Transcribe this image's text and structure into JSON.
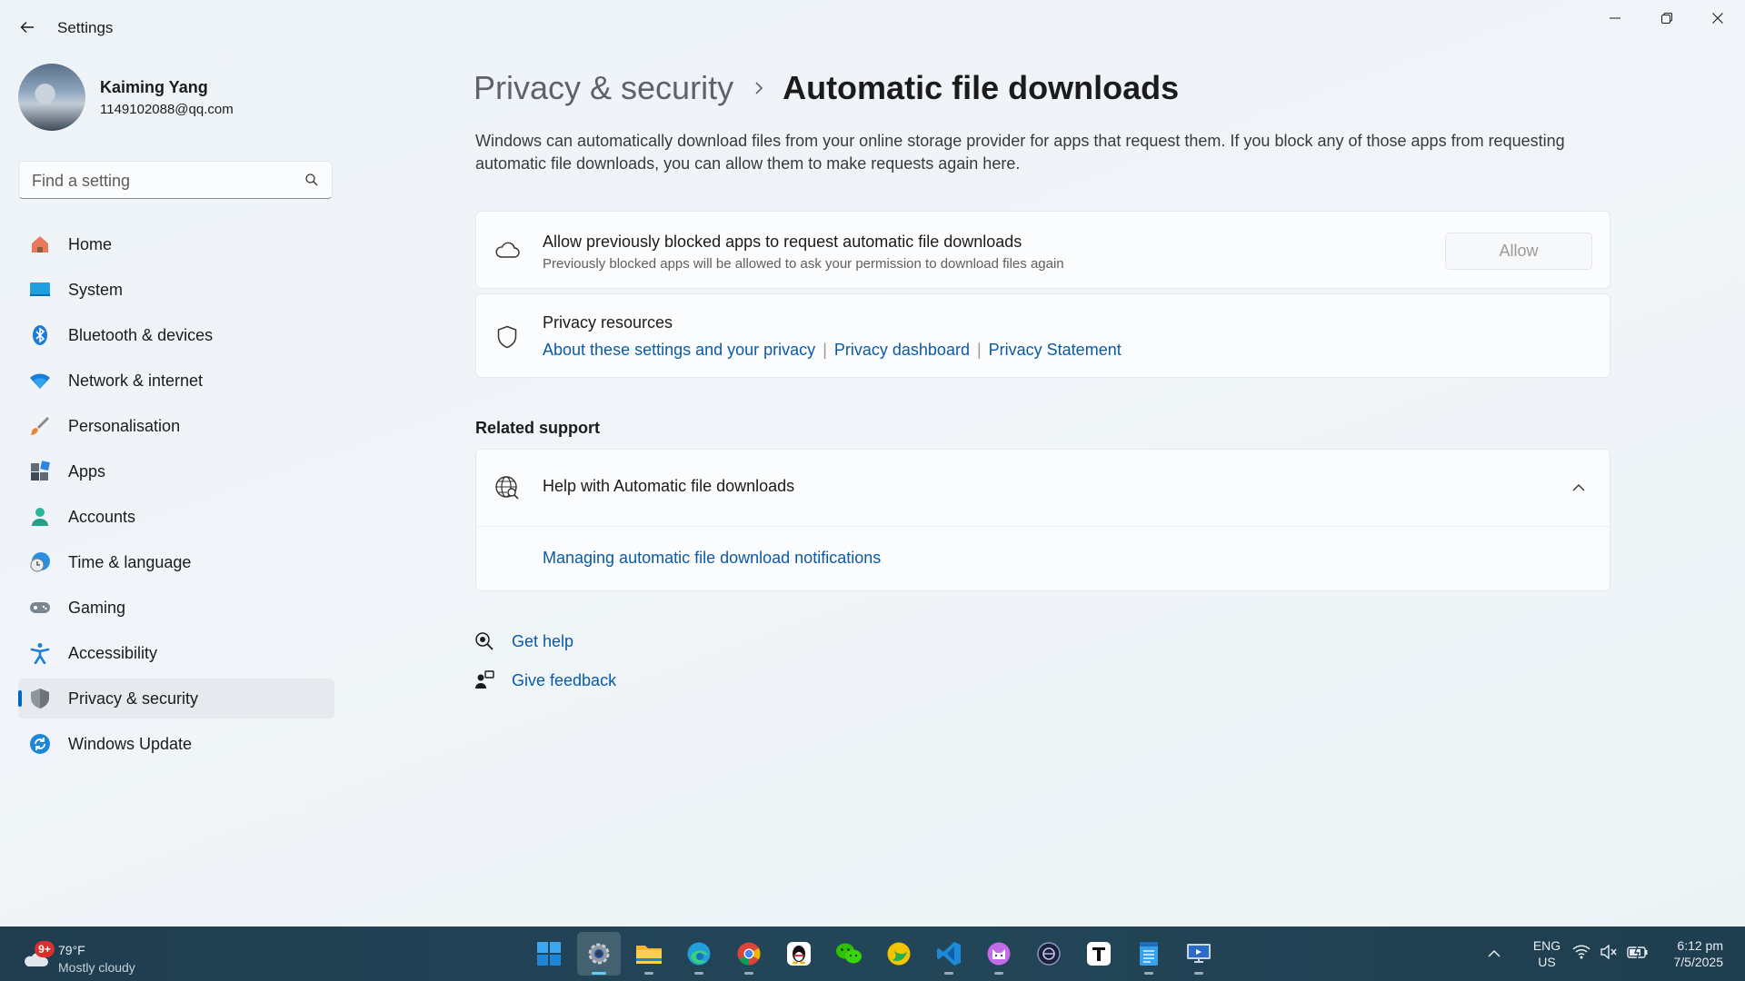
{
  "window": {
    "title": "Settings"
  },
  "user": {
    "name": "Kaiming Yang",
    "email": "1149102088@qq.com"
  },
  "search": {
    "placeholder": "Find a setting"
  },
  "sidebar": {
    "items": [
      {
        "label": "Home",
        "icon": "home-icon"
      },
      {
        "label": "System",
        "icon": "system-icon"
      },
      {
        "label": "Bluetooth & devices",
        "icon": "bluetooth-icon"
      },
      {
        "label": "Network & internet",
        "icon": "wifi-icon"
      },
      {
        "label": "Personalisation",
        "icon": "brush-icon"
      },
      {
        "label": "Apps",
        "icon": "apps-icon"
      },
      {
        "label": "Accounts",
        "icon": "accounts-icon"
      },
      {
        "label": "Time & language",
        "icon": "clock-globe-icon"
      },
      {
        "label": "Gaming",
        "icon": "gamepad-icon"
      },
      {
        "label": "Accessibility",
        "icon": "accessibility-icon"
      },
      {
        "label": "Privacy & security",
        "icon": "shield-icon",
        "active": true
      },
      {
        "label": "Windows Update",
        "icon": "update-icon"
      }
    ]
  },
  "breadcrumb": {
    "parent": "Privacy & security",
    "current": "Automatic file downloads"
  },
  "description": "Windows can automatically download files from your online storage provider for apps that request them. If you block any of those apps from requesting automatic file downloads, you can allow them to make requests again here.",
  "allow_card": {
    "title": "Allow previously blocked apps to request automatic file downloads",
    "subtitle": "Previously blocked apps will be allowed to ask your permission to download files again",
    "button": "Allow"
  },
  "privacy_card": {
    "title": "Privacy resources",
    "links": [
      "About these settings and your privacy",
      "Privacy dashboard",
      "Privacy Statement"
    ]
  },
  "related": {
    "heading": "Related support",
    "help_title": "Help with Automatic file downloads",
    "help_link": "Managing automatic file download notifications"
  },
  "footer": {
    "get_help": "Get help",
    "give_feedback": "Give feedback"
  },
  "taskbar": {
    "weather": {
      "badge": "9+",
      "temp": "79°F",
      "condition": "Mostly cloudy"
    },
    "apps": [
      "start",
      "settings",
      "file-explorer",
      "edge",
      "chrome",
      "qq",
      "wechat",
      "app-green",
      "vscode",
      "app-cat",
      "app-circle",
      "typora",
      "notepad",
      "remote-desktop"
    ],
    "lang": {
      "line1": "ENG",
      "line2": "US"
    },
    "clock": {
      "time": "6:12 pm",
      "date": "7/5/2025"
    }
  },
  "colors": {
    "accent": "#0067c0",
    "link": "#0a5aa8",
    "taskbar": "#1f3d4f"
  }
}
